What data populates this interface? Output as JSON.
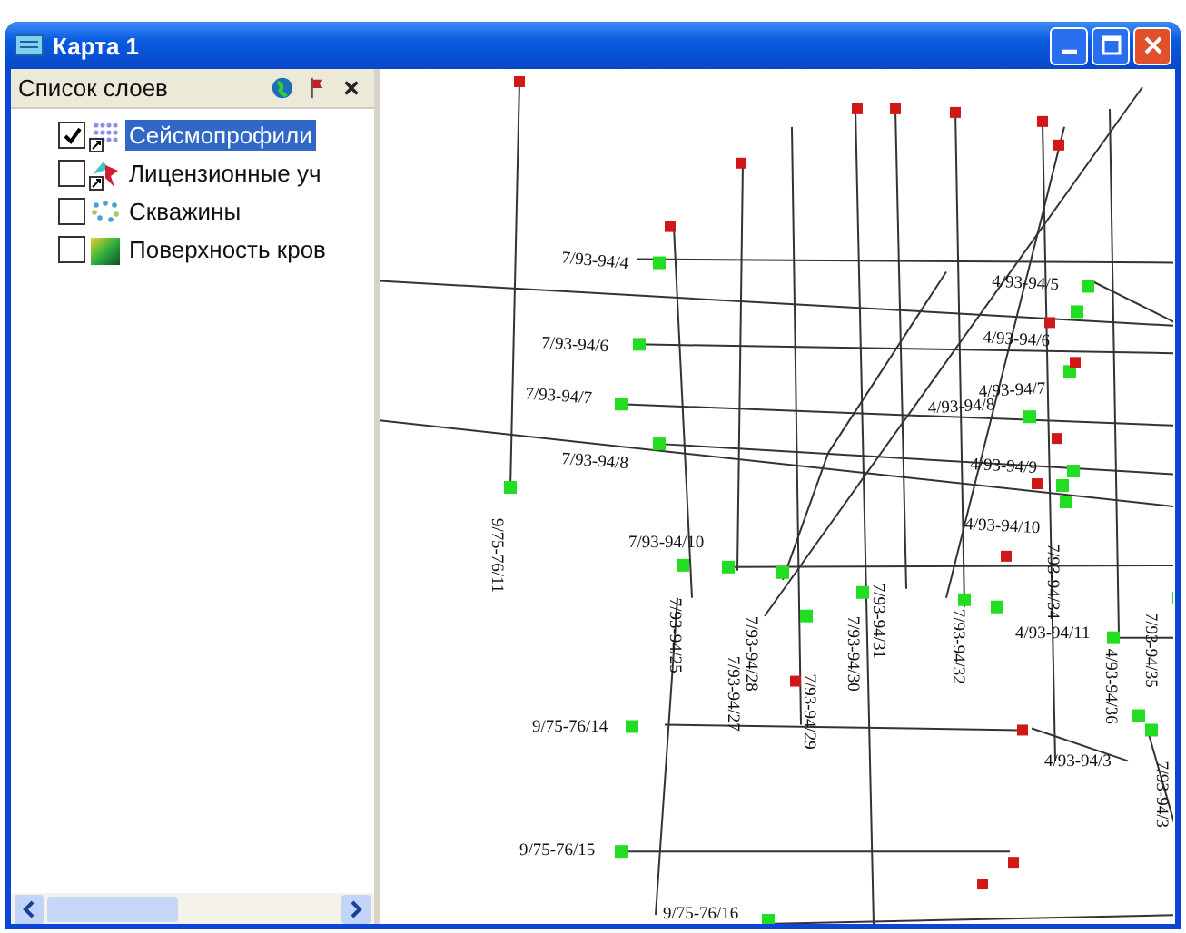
{
  "window": {
    "title": "Карта 1"
  },
  "layers_panel": {
    "title": "Список слоев",
    "layers": [
      {
        "label": "Сейсмопрофили",
        "checked": true,
        "selected": true,
        "kind": "profiles"
      },
      {
        "label": "Лицензионные уч",
        "checked": false,
        "selected": false,
        "kind": "areas"
      },
      {
        "label": "Скважины",
        "checked": false,
        "selected": false,
        "kind": "wells"
      },
      {
        "label": "Поверхность кров",
        "checked": false,
        "selected": false,
        "kind": "surface"
      }
    ]
  },
  "map": {
    "labels": [
      "7/93-94/4",
      "7/93-94/6",
      "7/93-94/7",
      "7/93-94/8",
      "9/75-76/11",
      "7/93-94/10",
      "7/93-94/25",
      "7/93-94/28",
      "7/93-94/27",
      "7/93-94/30",
      "7/93-94/31",
      "7/93-94/29",
      "7/93-94/32",
      "4/93-94/5",
      "4/93-94/6",
      "4/93-94/7",
      "4/93-94/8",
      "4/93-94/9",
      "4/93-94/10",
      "7/93-94/34",
      "4/93-94/11",
      "4/93-94/36",
      "7/93-94/35",
      "4/93-94/3",
      "7/93-94/3",
      "9/75-76/14",
      "9/75-76/15",
      "9/75-76/16"
    ]
  }
}
